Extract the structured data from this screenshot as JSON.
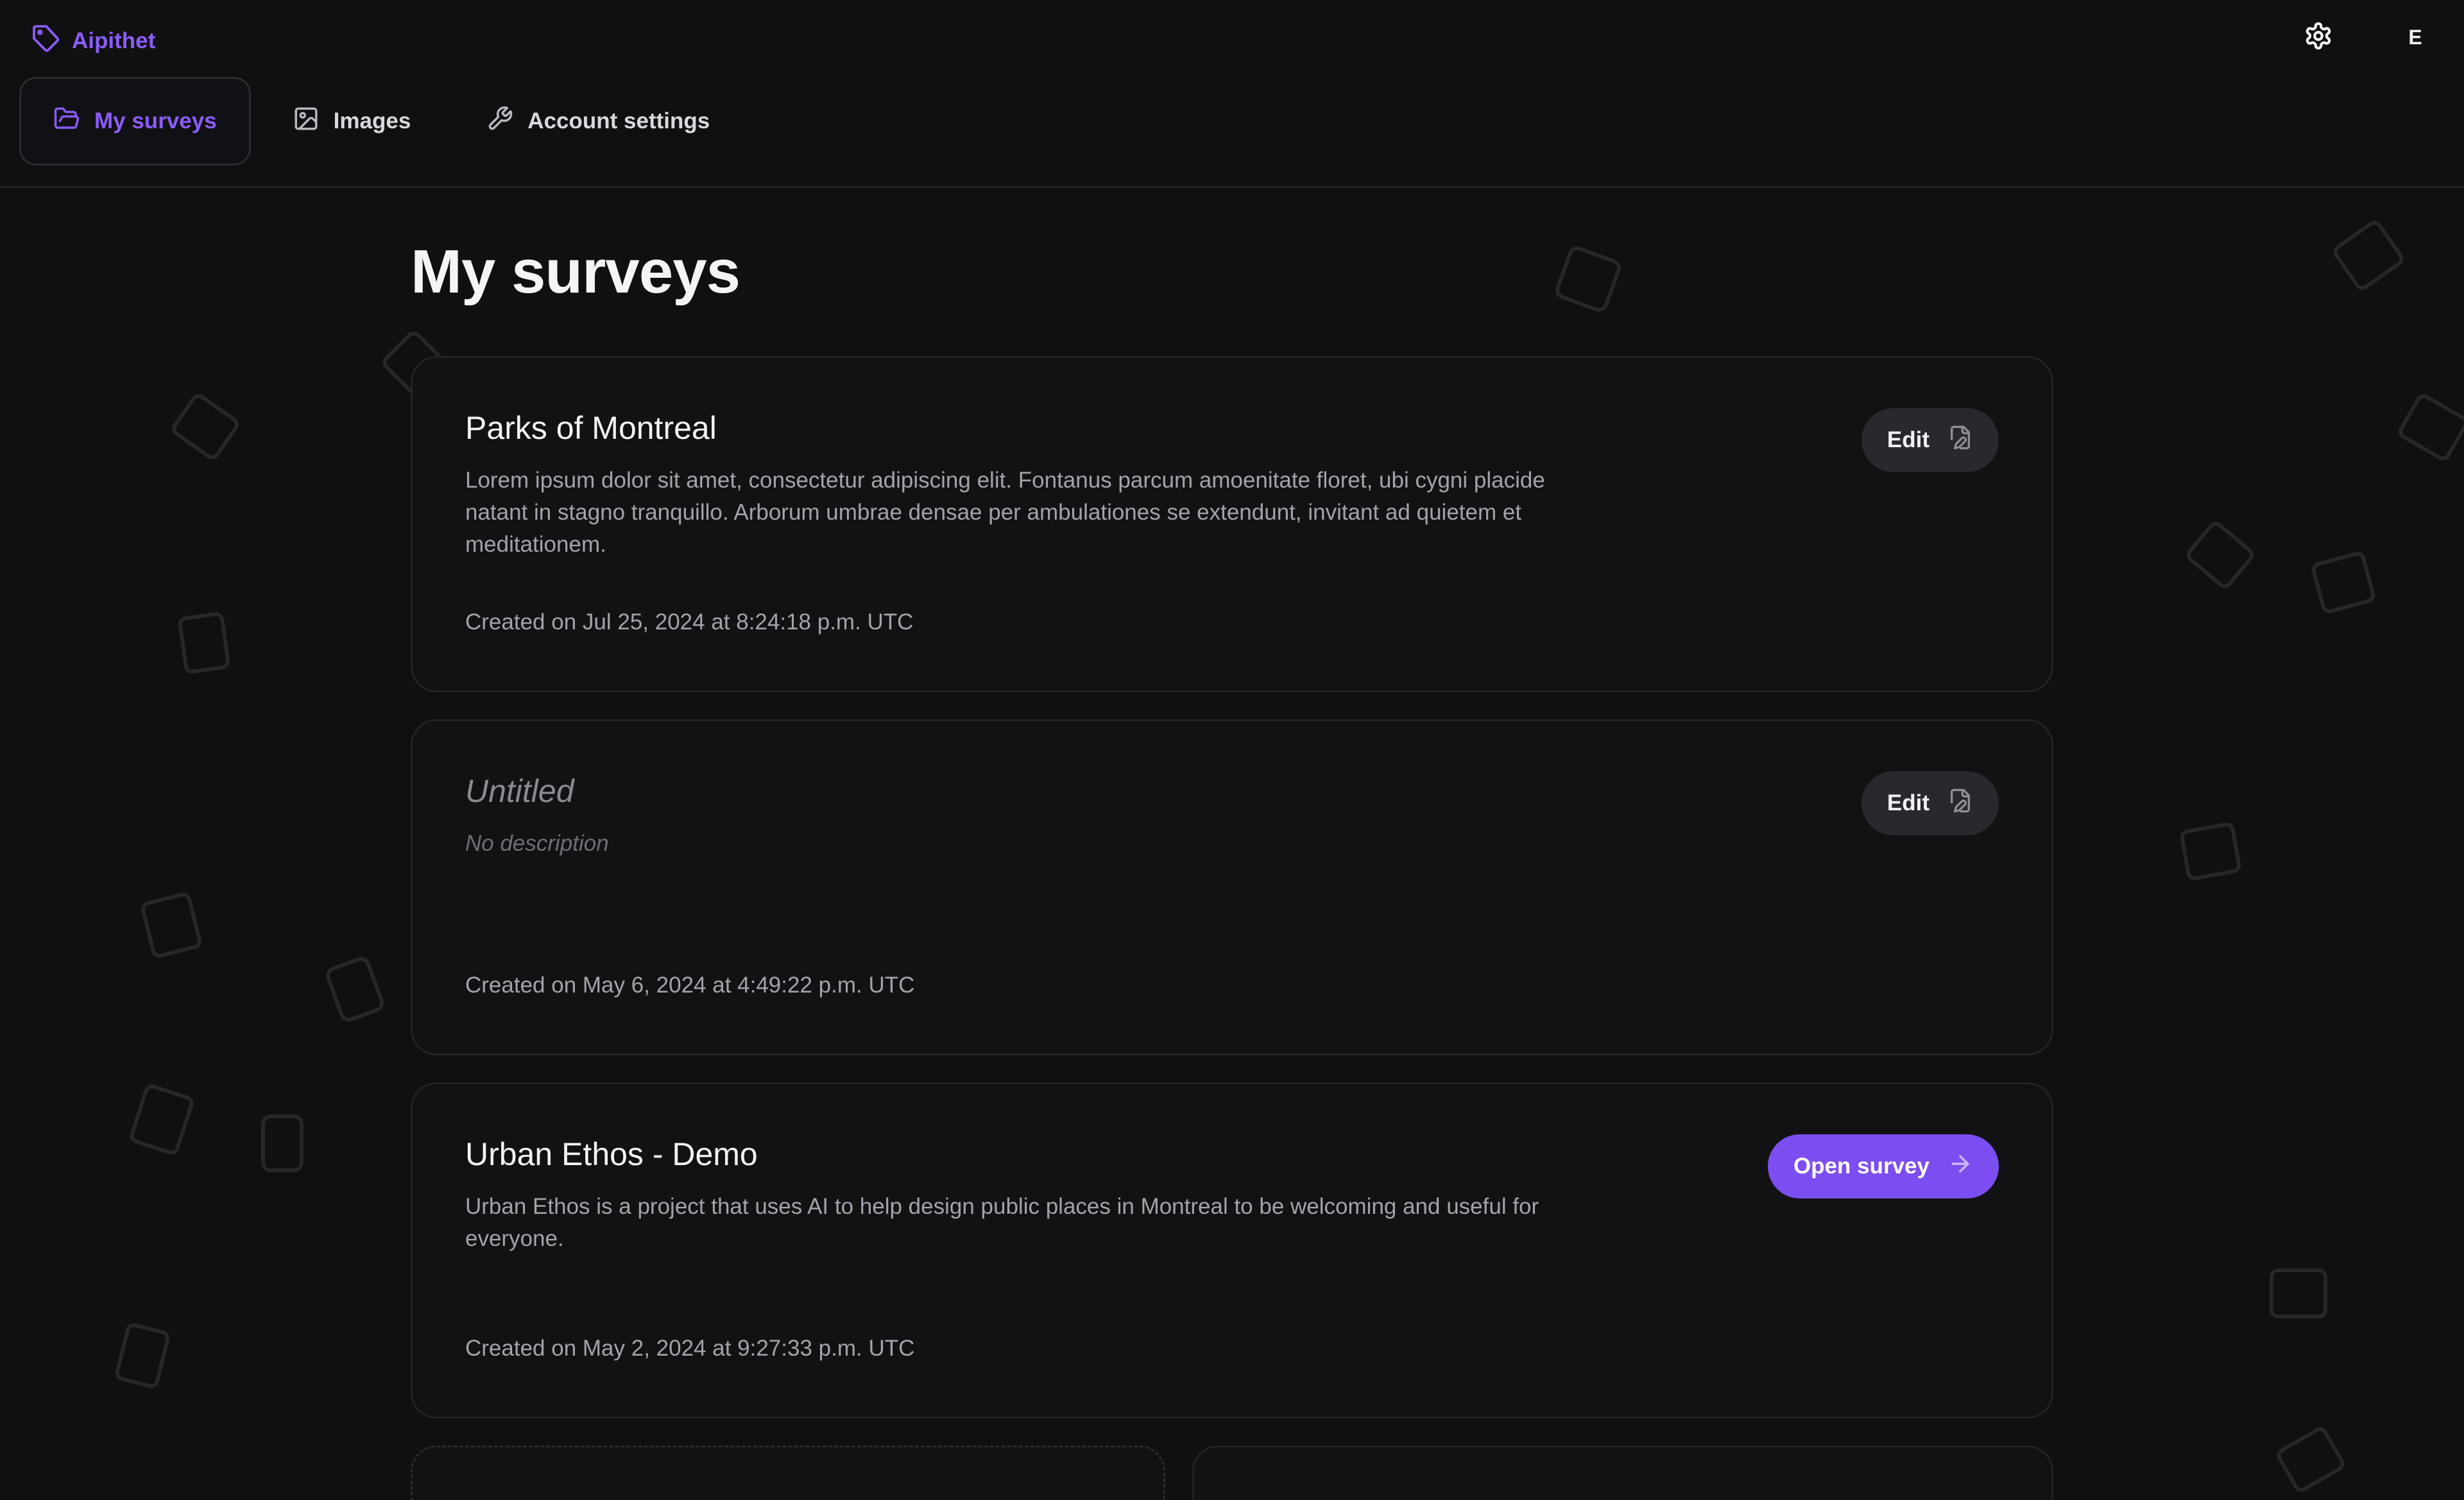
{
  "app": {
    "brand": "Aipithet",
    "user_initial": "E"
  },
  "colors": {
    "accent": "#8b5cf6",
    "background": "#101012",
    "card": "#121215"
  },
  "icons": {
    "brand": "tag-icon",
    "settings": "gear-icon",
    "edit": "file-pen-icon",
    "open": "arrow-right-icon"
  },
  "tabs": [
    {
      "label": "My surveys",
      "icon": "folder-open-icon",
      "active": true
    },
    {
      "label": "Images",
      "icon": "image-icon",
      "active": false
    },
    {
      "label": "Account settings",
      "icon": "wrench-icon",
      "active": false
    }
  ],
  "page": {
    "title": "My surveys"
  },
  "surveys": [
    {
      "title": "Parks of Montreal",
      "description": "Lorem ipsum dolor sit amet, consectetur adipiscing elit. Fontanus parcum amoenitate floret, ubi cygni placide natant in stagno tranquillo. Arborum umbrae densae per ambulationes se extendunt, invitant ad quietem et meditationem.",
      "created": "Created on Jul 25, 2024 at 8:24:18 p.m. UTC",
      "action": "Edit"
    },
    {
      "title": "Untitled",
      "description": "No description",
      "created": "Created on May 6, 2024 at 4:49:22 p.m. UTC",
      "action": "Edit"
    },
    {
      "title": "Urban Ethos - Demo",
      "description": "Urban Ethos is a project that uses AI to help design public places in Montreal to be welcoming and useful for everyone.",
      "created": "Created on May 2, 2024 at 9:27:33 p.m. UTC",
      "action": "Open survey"
    }
  ]
}
